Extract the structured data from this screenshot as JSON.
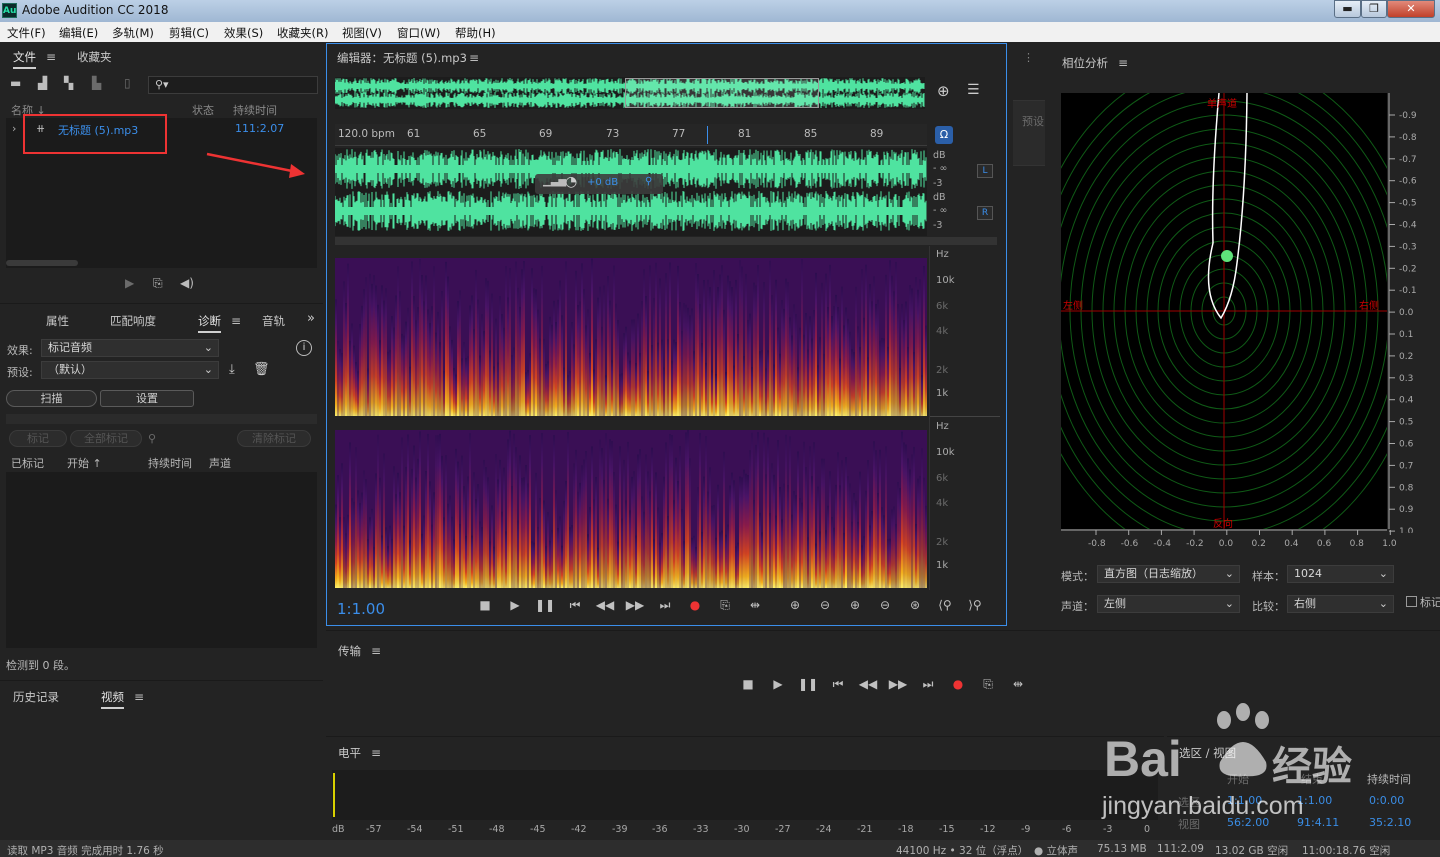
{
  "window": {
    "title": "Adobe Audition CC 2018",
    "logo": "Au",
    "min": "▬",
    "max": "❐",
    "close": "✕"
  },
  "menu": [
    "文件(F)",
    "编辑(E)",
    "多轨(M)",
    "剪辑(C)",
    "效果(S)",
    "收藏夹(R)",
    "视图(V)",
    "窗口(W)",
    "帮助(H)"
  ],
  "files_panel": {
    "tab_files": "文件",
    "tab_favorites": "收藏夹",
    "col_name": "名称 ↓",
    "col_status": "状态",
    "col_duration": "持续时间",
    "file_name": "无标题 (5).mp3",
    "file_duration": "111:2.07"
  },
  "props_panel": {
    "tabs": [
      "属性",
      "匹配响度",
      "诊断",
      "音轨"
    ],
    "effect_label": "效果:",
    "effect_value": "标记音频",
    "preset_label": "预设:",
    "preset_value": "（默认）",
    "scan_button": "扫描",
    "settings_button": "设置",
    "mark_button": "标记",
    "mark_all_button": "全部标记",
    "clear_marks_button": "清除标记",
    "col_marked": "已标记",
    "col_start": "开始 ↑",
    "col_duration": "持续时间",
    "col_channel": "声道",
    "detected": "检测到 0 段。"
  },
  "history_panel": {
    "tab_history": "历史记录",
    "tab_video": "视频"
  },
  "editor": {
    "title": "编辑器：无标题 (5).mp3",
    "bpm": "120.0 bpm",
    "beats": [
      "61",
      "65",
      "69",
      "73",
      "77",
      "81",
      "85",
      "89"
    ],
    "db_labels": [
      "dB",
      "- ∞",
      "-3"
    ],
    "channel_left": "L",
    "channel_right": "R",
    "hud_gain": "+0 dB",
    "hz_labels": [
      "Hz",
      "10k",
      "6k",
      "4k",
      "2k",
      "1k"
    ],
    "zoom": "1:1.00"
  },
  "presets_label": "预设",
  "phase": {
    "title": "相位分析",
    "top_label": "单声道",
    "left_label": "左侧",
    "right_label": "右侧",
    "bottom_label": "反向",
    "right_ticks": [
      "-0.9",
      "-0.8",
      "-0.7",
      "-0.6",
      "-0.5",
      "-0.4",
      "-0.3",
      "-0.2",
      "-0.1",
      "0.0",
      "0.1",
      "0.2",
      "0.3",
      "0.4",
      "0.5",
      "0.6",
      "0.7",
      "0.8",
      "0.9",
      "1.0"
    ],
    "bottom_ticks": [
      "-0.8",
      "-0.6",
      "-0.4",
      "-0.2",
      "0.0",
      "0.2",
      "0.4",
      "0.6",
      "0.8",
      "1.0"
    ],
    "mode_label": "模式：",
    "mode_value": "直方图（日志缩放）",
    "sample_label": "样本：",
    "sample_value": "1024",
    "channel_label": "声道：",
    "channel_value": "左侧",
    "compare_label": "比较：",
    "compare_value": "右侧",
    "checkbox_label": "标记"
  },
  "transport": {
    "title": "传输"
  },
  "levels": {
    "title": "电平",
    "ticks": [
      "dB",
      "-57",
      "-54",
      "-51",
      "-48",
      "-45",
      "-42",
      "-39",
      "-36",
      "-33",
      "-30",
      "-27",
      "-24",
      "-21",
      "-18",
      "-15",
      "-12",
      "-9",
      "-6",
      "-3",
      "0"
    ]
  },
  "selection": {
    "title": "选区 / 视图",
    "col_start": "开始",
    "col_end": "结束",
    "col_duration": "持续时间",
    "row_sel": "选区",
    "row_view": "视图",
    "sel_start": "1:1.00",
    "sel_end": "1:1.00",
    "sel_dur": "0:0.00",
    "view_start": "56:2.00",
    "view_end": "91:4.11",
    "view_dur": "35:2.10"
  },
  "watermark": {
    "brand": "Bai",
    "brand2": "经验",
    "url": "jingyan.baidu.com"
  },
  "statusbar": {
    "left": "读取 MP3 音频 完成用时 1.76 秒",
    "format": "44100 Hz • 32 位（浮点）",
    "channels": "● 立体声",
    "size": "75.13 MB",
    "duration": "111:2.09",
    "free": "13.02 GB 空闲",
    "free_time": "11:00:18.76 空闲"
  },
  "colors": {
    "waveform": "#4fe3a0",
    "accent": "#3b8eea",
    "red_box": "#e33",
    "sel_blue": "#3a8de5"
  }
}
